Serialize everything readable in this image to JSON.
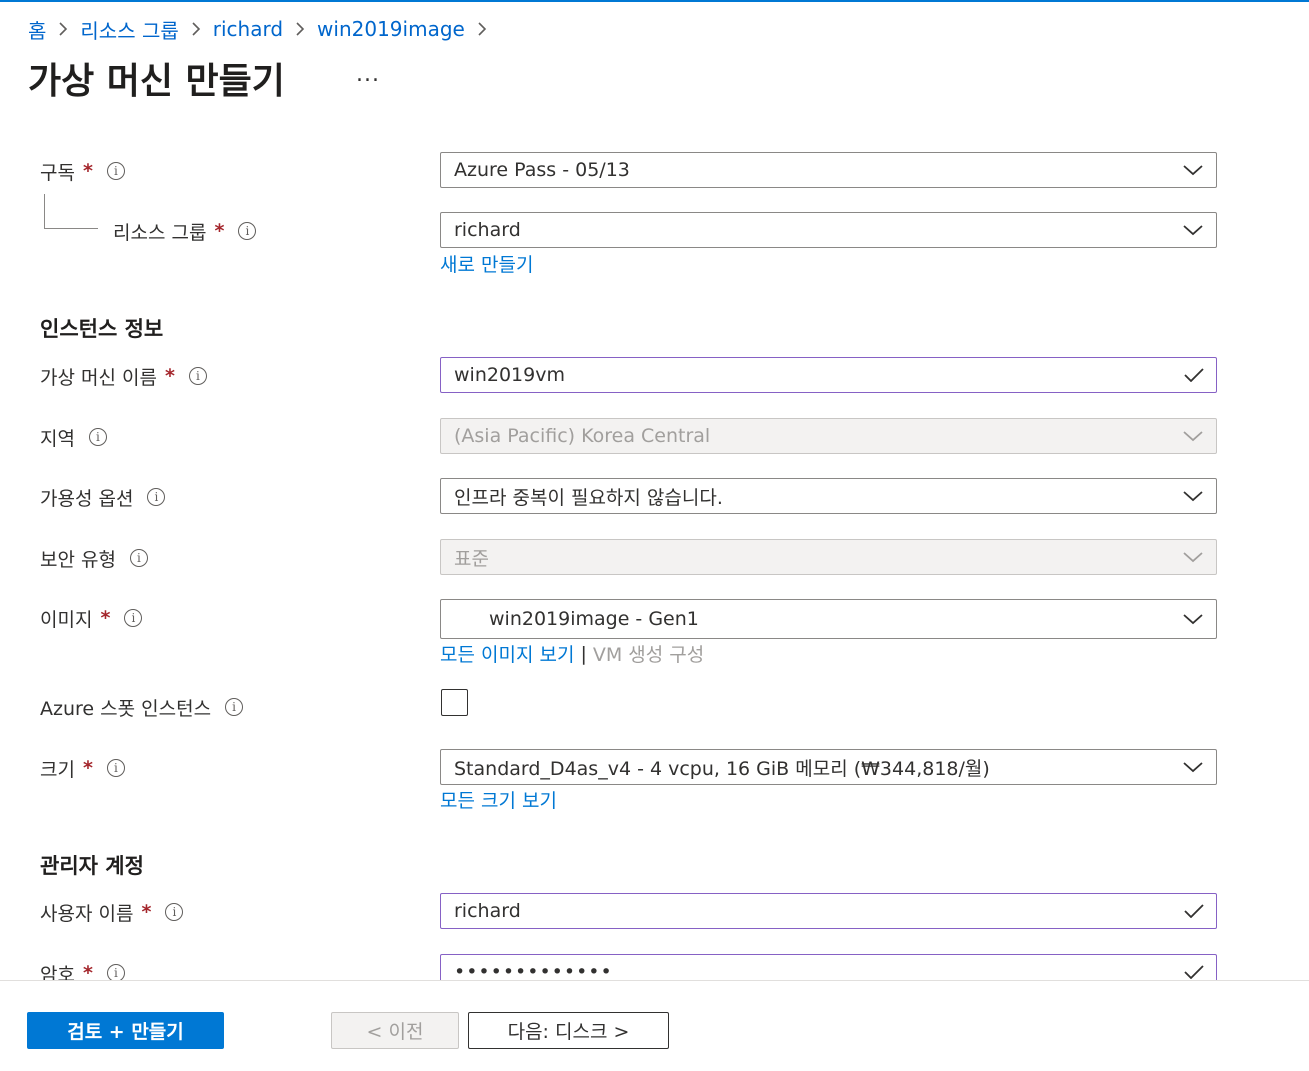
{
  "breadcrumb": [
    "홈",
    "리소스 그룹",
    "richard",
    "win2019image"
  ],
  "page_title": "가상 머신 만들기",
  "more": "...",
  "info_glyph": "i",
  "required_mark": "*",
  "basics": {
    "subscription": {
      "label": "구독",
      "value": "Azure Pass - 05/13"
    },
    "resource_group": {
      "label": "리소스 그룹",
      "value": "richard",
      "create_new": "새로 만들기"
    }
  },
  "instance": {
    "section_title": "인스턴스 정보",
    "vm_name": {
      "label": "가상 머신 이름",
      "value": "win2019vm"
    },
    "region": {
      "label": "지역",
      "value": "(Asia Pacific) Korea Central"
    },
    "availability": {
      "label": "가용성 옵션",
      "value": "인프라 중복이 필요하지 않습니다."
    },
    "security_type": {
      "label": "보안 유형",
      "value": "표준"
    },
    "image": {
      "label": "이미지",
      "value": "win2019image - Gen1",
      "see_all": "모든 이미지 보기",
      "separator": "|",
      "configure": "VM 생성 구성"
    },
    "spot": {
      "label": "Azure 스폿 인스턴스",
      "checked": false
    },
    "size": {
      "label": "크기",
      "value": "Standard_D4as_v4 - 4 vcpu, 16 GiB 메모리 (₩344,818/월)",
      "see_all": "모든 크기 보기"
    }
  },
  "admin": {
    "section_title": "관리자 계정",
    "username": {
      "label": "사용자 이름",
      "value": "richard"
    },
    "password": {
      "label": "암호",
      "value": "•••••••••••••"
    }
  },
  "footer": {
    "review_create": "검토 + 만들기",
    "previous": "< 이전",
    "next": "다음: 디스크 >"
  },
  "colors": {
    "accent": "#0078d4",
    "link": "#0066cc",
    "valid_border": "#8661c5",
    "required": "#a4262c",
    "disabled_bg": "#f3f2f1"
  },
  "icons": {
    "chevron": "chevron-down-icon",
    "check": "checkmark-icon",
    "info": "info-icon",
    "separator": "chevron-right-icon"
  }
}
